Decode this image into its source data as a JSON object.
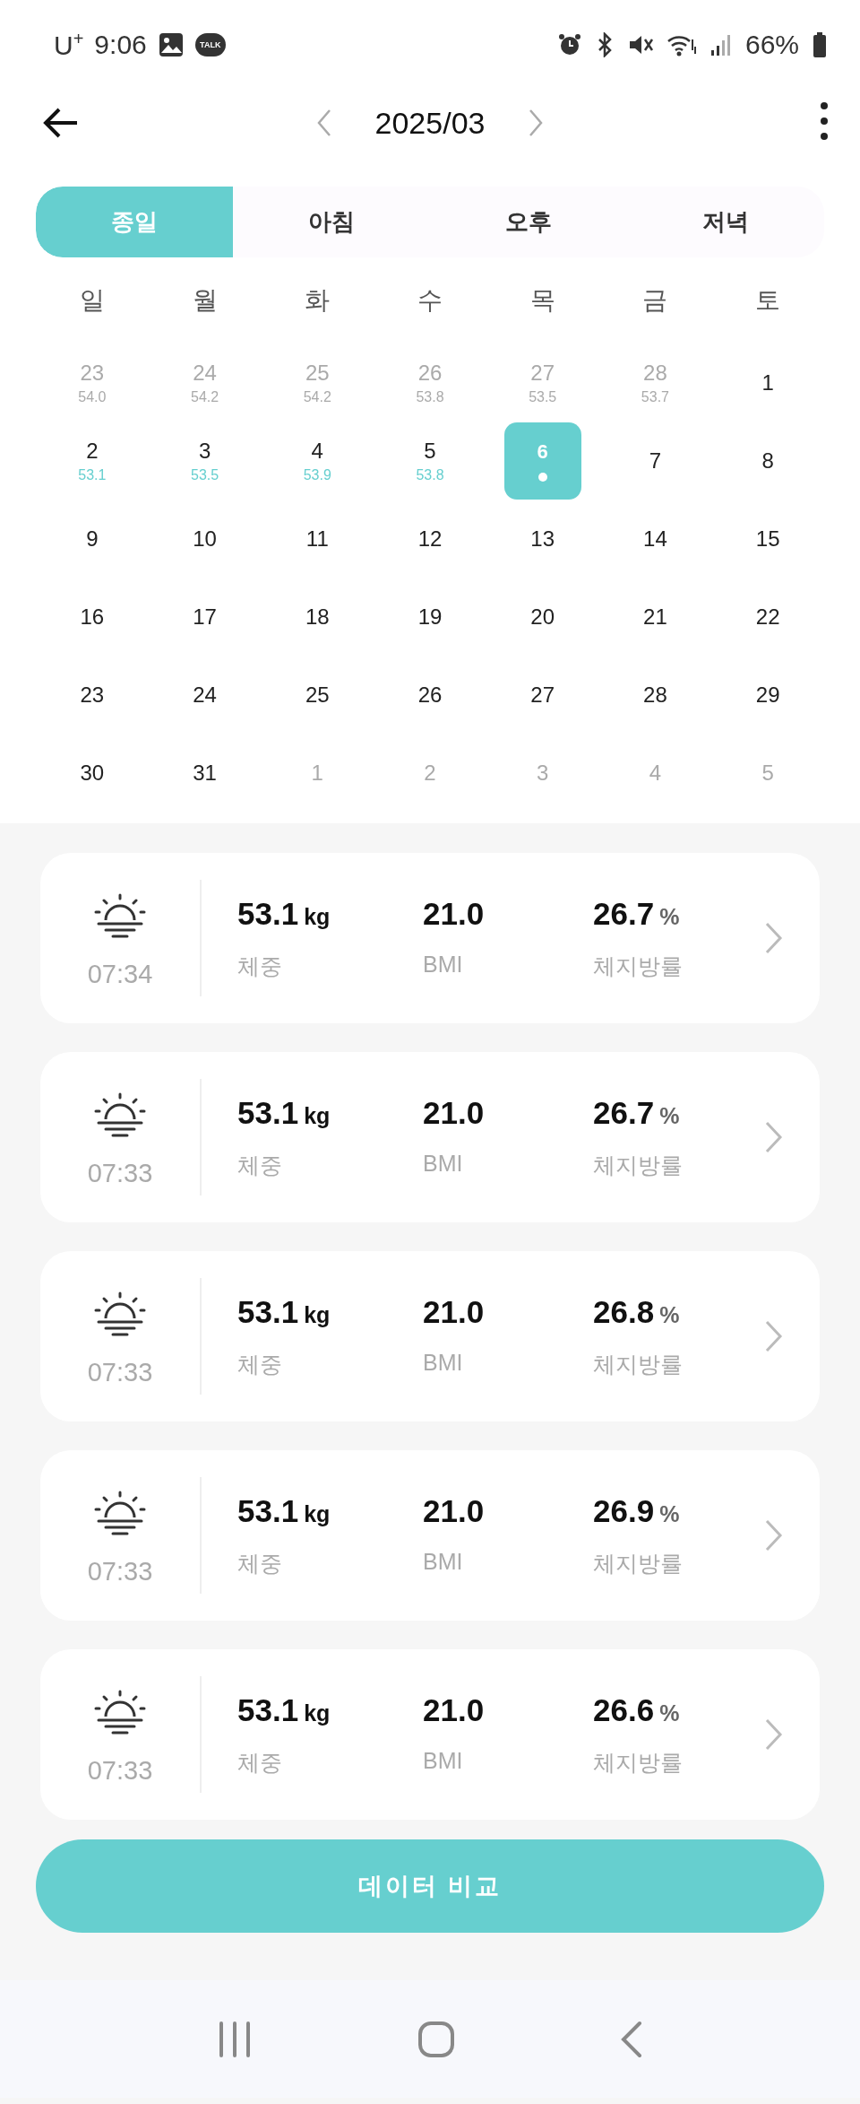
{
  "status_bar": {
    "carrier": "U$^{+}$",
    "time": "9:06",
    "chat_badge": "TALK",
    "battery": "66%"
  },
  "header": {
    "month": "2025/03"
  },
  "tabs": [
    {
      "label": "종일",
      "selected": true
    },
    {
      "label": "아침",
      "selected": false
    },
    {
      "label": "오후",
      "selected": false
    },
    {
      "label": "저녁",
      "selected": false
    }
  ],
  "calendar": {
    "weekdays": [
      "일",
      "월",
      "화",
      "수",
      "목",
      "금",
      "토"
    ],
    "days": [
      {
        "day": "23",
        "weight": "54.0",
        "kind": "prev",
        "selected": false
      },
      {
        "day": "24",
        "weight": "54.2",
        "kind": "prev",
        "selected": false
      },
      {
        "day": "25",
        "weight": "54.2",
        "kind": "prev",
        "selected": false
      },
      {
        "day": "26",
        "weight": "53.8",
        "kind": "prev",
        "selected": false
      },
      {
        "day": "27",
        "weight": "53.5",
        "kind": "prev",
        "selected": false
      },
      {
        "day": "28",
        "weight": "53.7",
        "kind": "prev",
        "selected": false
      },
      {
        "day": "1",
        "kind": "current",
        "selected": false
      },
      {
        "day": "2",
        "weight": "53.1",
        "kind": "current",
        "selected": false
      },
      {
        "day": "3",
        "weight": "53.5",
        "kind": "current",
        "selected": false
      },
      {
        "day": "4",
        "weight": "53.9",
        "kind": "current",
        "selected": false
      },
      {
        "day": "5",
        "weight": "53.8",
        "kind": "current",
        "selected": false
      },
      {
        "day": "6",
        "kind": "current",
        "selected": true
      },
      {
        "day": "7",
        "kind": "current",
        "selected": false
      },
      {
        "day": "8",
        "kind": "current",
        "selected": false
      },
      {
        "day": "9",
        "kind": "current",
        "selected": false
      },
      {
        "day": "10",
        "kind": "current",
        "selected": false
      },
      {
        "day": "11",
        "kind": "current",
        "selected": false
      },
      {
        "day": "12",
        "kind": "current",
        "selected": false
      },
      {
        "day": "13",
        "kind": "current",
        "selected": false
      },
      {
        "day": "14",
        "kind": "current",
        "selected": false
      },
      {
        "day": "15",
        "kind": "current",
        "selected": false
      },
      {
        "day": "16",
        "kind": "current",
        "selected": false
      },
      {
        "day": "17",
        "kind": "current",
        "selected": false
      },
      {
        "day": "18",
        "kind": "current",
        "selected": false
      },
      {
        "day": "19",
        "kind": "current",
        "selected": false
      },
      {
        "day": "20",
        "kind": "current",
        "selected": false
      },
      {
        "day": "21",
        "kind": "current",
        "selected": false
      },
      {
        "day": "22",
        "kind": "current",
        "selected": false
      },
      {
        "day": "23",
        "kind": "current",
        "selected": false
      },
      {
        "day": "24",
        "kind": "current",
        "selected": false
      },
      {
        "day": "25",
        "kind": "current",
        "selected": false
      },
      {
        "day": "26",
        "kind": "current",
        "selected": false
      },
      {
        "day": "27",
        "kind": "current",
        "selected": false
      },
      {
        "day": "28",
        "kind": "current",
        "selected": false
      },
      {
        "day": "29",
        "kind": "current",
        "selected": false
      },
      {
        "day": "30",
        "kind": "current",
        "selected": false
      },
      {
        "day": "31",
        "kind": "current",
        "selected": false
      },
      {
        "day": "1",
        "kind": "next",
        "selected": false
      },
      {
        "day": "2",
        "kind": "next",
        "selected": false
      },
      {
        "day": "3",
        "kind": "next",
        "selected": false
      },
      {
        "day": "4",
        "kind": "next",
        "selected": false
      },
      {
        "day": "5",
        "kind": "next",
        "selected": false
      }
    ]
  },
  "records": [
    {
      "time": "07:34",
      "weight": "53.1",
      "weight_unit": "kg",
      "weight_label": "체중",
      "bmi": "21.0",
      "bmi_label": "BMI",
      "fat": "26.7",
      "fat_unit": "%",
      "fat_label": "체지방률"
    },
    {
      "time": "07:33",
      "weight": "53.1",
      "weight_unit": "kg",
      "weight_label": "체중",
      "bmi": "21.0",
      "bmi_label": "BMI",
      "fat": "26.7",
      "fat_unit": "%",
      "fat_label": "체지방률"
    },
    {
      "time": "07:33",
      "weight": "53.1",
      "weight_unit": "kg",
      "weight_label": "체중",
      "bmi": "21.0",
      "bmi_label": "BMI",
      "fat": "26.8",
      "fat_unit": "%",
      "fat_label": "체지방률"
    },
    {
      "time": "07:33",
      "weight": "53.1",
      "weight_unit": "kg",
      "weight_label": "체중",
      "bmi": "21.0",
      "bmi_label": "BMI",
      "fat": "26.9",
      "fat_unit": "%",
      "fat_label": "체지방률"
    },
    {
      "time": "07:33",
      "weight": "53.1",
      "weight_unit": "kg",
      "weight_label": "체중",
      "bmi": "21.0",
      "bmi_label": "BMI",
      "fat": "26.6",
      "fat_unit": "%",
      "fat_label": "체지방률"
    }
  ],
  "compare_button": "데이터 비교"
}
